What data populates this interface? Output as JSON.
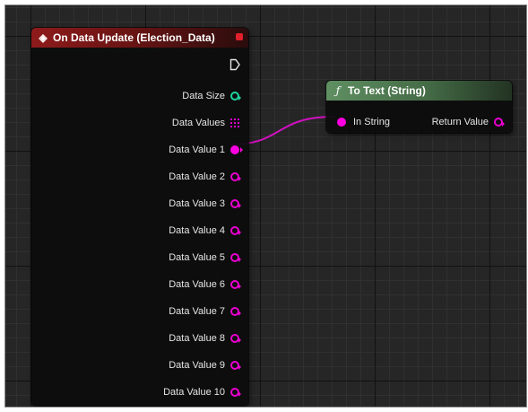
{
  "event_node": {
    "title": "On Data Update (Election_Data)",
    "icon": "event-diamond-icon",
    "header_color": "#8e1b1b",
    "outputs": {
      "data_size": "Data Size",
      "data_values": "Data Values",
      "data_value_1": "Data Value 1",
      "data_value_2": "Data Value 2",
      "data_value_3": "Data Value 3",
      "data_value_4": "Data Value 4",
      "data_value_5": "Data Value 5",
      "data_value_6": "Data Value 6",
      "data_value_7": "Data Value 7",
      "data_value_8": "Data Value 8",
      "data_value_9": "Data Value 9",
      "data_value_10": "Data Value 10"
    }
  },
  "function_node": {
    "title": "To Text (String)",
    "icon": "function-f-icon",
    "header_color": "#5f8f62",
    "input_label": "In String",
    "output_label": "Return Value"
  },
  "colors": {
    "string_pin": "#ff00e0",
    "integer_pin": "#1ed5a0",
    "wire": "#d010c0",
    "graph_bg": "#262626"
  }
}
